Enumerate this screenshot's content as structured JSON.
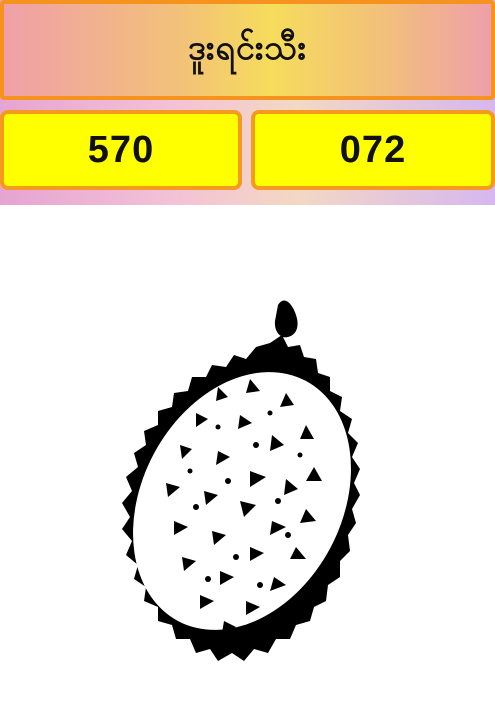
{
  "header": {
    "title": "ဒူးရင်းသီး"
  },
  "numbers": {
    "left": "570",
    "right": "072"
  },
  "image": {
    "icon": "durian-fruit-illustration"
  },
  "colors": {
    "title_border": "#f6931e",
    "number_bg": "#ffff00",
    "number_border": "#f39a1f"
  }
}
